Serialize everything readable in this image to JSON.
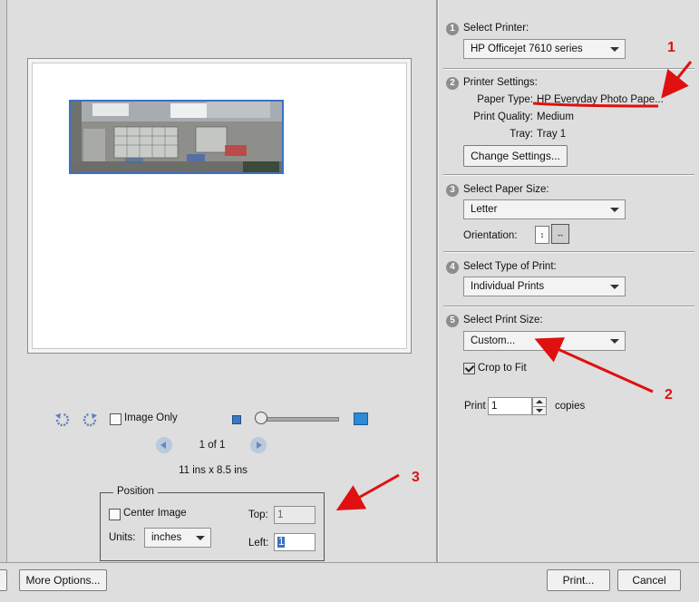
{
  "preview": {
    "image_only_label": "Image Only",
    "page_indicator": "1 of 1",
    "page_size": "11 ins x 8.5 ins",
    "position": {
      "legend": "Position",
      "center_image_label": "Center Image",
      "center_image_checked": false,
      "units_label": "Units:",
      "units_value": "inches",
      "top_label": "Top:",
      "top_value": "1",
      "left_label": "Left:",
      "left_value": "1"
    }
  },
  "settings": {
    "step1": {
      "num": "1",
      "title": "Select Printer:",
      "printer": "HP Officejet 7610 series"
    },
    "step2": {
      "num": "2",
      "title": "Printer Settings:",
      "paper_type_label": "Paper Type:",
      "paper_type_value": "HP Everyday Photo Pape...",
      "print_quality_label": "Print Quality:",
      "print_quality_value": "Medium",
      "tray_label": "Tray:",
      "tray_value": "Tray 1",
      "change_settings_button": "Change Settings..."
    },
    "step3": {
      "num": "3",
      "title": "Select Paper Size:",
      "paper_size": "Letter",
      "orientation_label": "Orientation:"
    },
    "step4": {
      "num": "4",
      "title": "Select Type of Print:",
      "print_type": "Individual Prints"
    },
    "step5": {
      "num": "5",
      "title": "Select Print Size:",
      "print_size": "Custom...",
      "crop_to_fit_label": "Crop to Fit",
      "crop_to_fit_checked": true,
      "print_label": "Print",
      "copies_value": "1",
      "copies_label": "copies"
    }
  },
  "footer": {
    "more_options_button": "More Options...",
    "print_button": "Print...",
    "cancel_button": "Cancel"
  },
  "annotations": {
    "marker1": "1",
    "marker2": "2",
    "marker3": "3",
    "color": "#e01010"
  }
}
